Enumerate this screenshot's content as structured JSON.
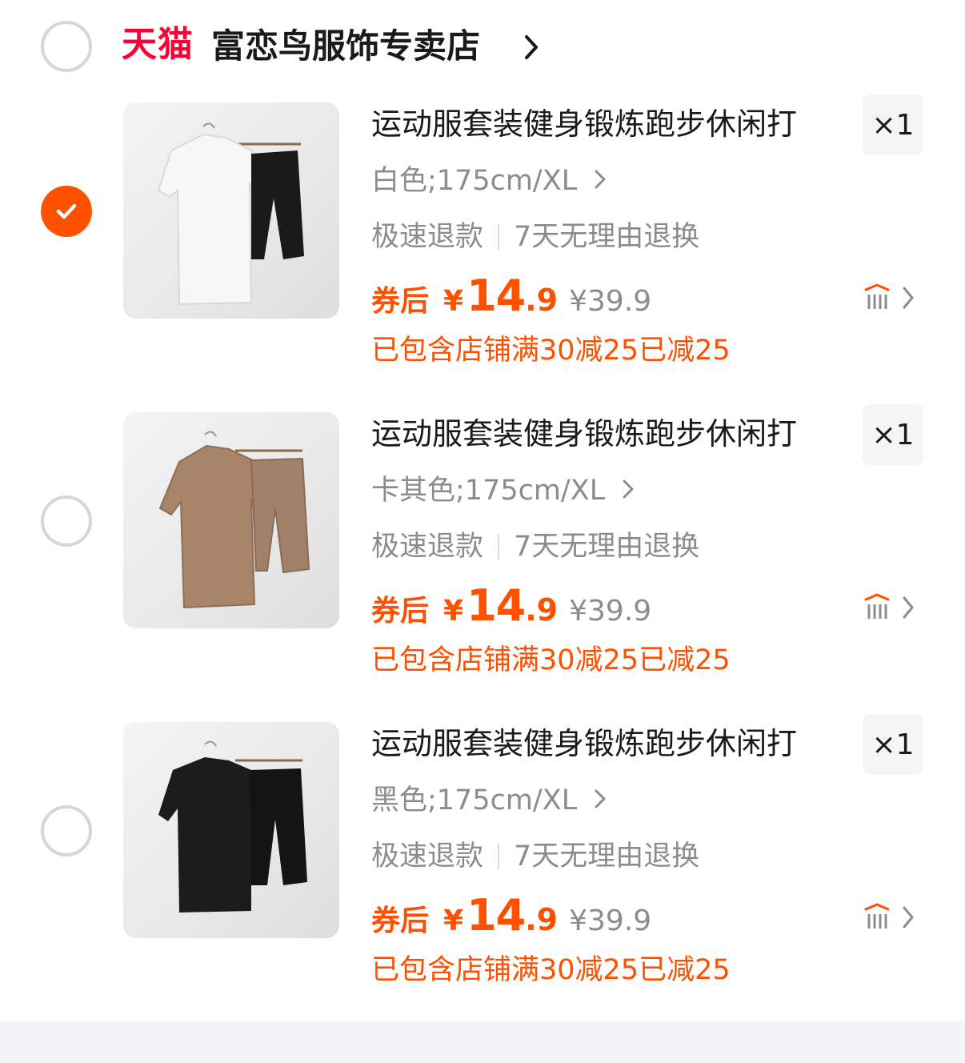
{
  "shop": {
    "platform_logo": "天猫",
    "name": "富恋鸟服饰专卖店",
    "selected": false
  },
  "items": [
    {
      "selected": true,
      "image_desc": "white-tshirt-black-shorts",
      "title": "运动服套装健身锻炼跑步休闲打",
      "quantity": "×1",
      "sku": "白色;175cm/XL",
      "service_1": "极速退款",
      "service_2": "7天无理由退换",
      "coupon_label": "券后",
      "currency": "¥",
      "price_int": "14",
      "price_dec": ".9",
      "original_price": "¥39.9",
      "promo": "已包含店铺满30减25已减25"
    },
    {
      "selected": false,
      "image_desc": "khaki-tshirt-khaki-shorts",
      "title": "运动服套装健身锻炼跑步休闲打",
      "quantity": "×1",
      "sku": "卡其色;175cm/XL",
      "service_1": "极速退款",
      "service_2": "7天无理由退换",
      "coupon_label": "券后",
      "currency": "¥",
      "price_int": "14",
      "price_dec": ".9",
      "original_price": "¥39.9",
      "promo": "已包含店铺满30减25已减25"
    },
    {
      "selected": false,
      "image_desc": "black-tshirt-black-shorts",
      "title": "运动服套装健身锻炼跑步休闲打",
      "quantity": "×1",
      "sku": "黑色;175cm/XL",
      "service_1": "极速退款",
      "service_2": "7天无理由退换",
      "coupon_label": "券后",
      "currency": "¥",
      "price_int": "14",
      "price_dec": ".9",
      "original_price": "¥39.9",
      "promo": "已包含店铺满30减25已减25"
    }
  ],
  "colors": {
    "accent": "#ff5000",
    "tmall_red": "#ff0036",
    "text_primary": "#1a1a1a",
    "text_secondary": "#8c8c8c",
    "radio_border": "#d6d6d6"
  },
  "icons": {
    "shop_chevron": "chevron-right-icon",
    "check": "check-icon",
    "similar": "find-similar-icon"
  }
}
